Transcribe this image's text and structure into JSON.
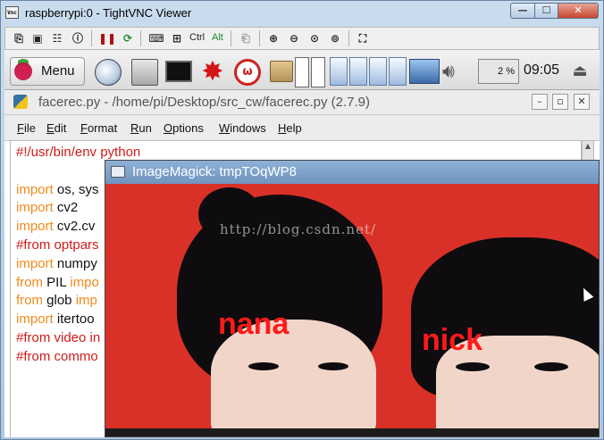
{
  "vnc": {
    "title": "raspberrypi:0 - TightVNC Viewer",
    "app_icon": "Vnc",
    "controls": {
      "minimize": "—",
      "maximize": "☐",
      "close": "✕"
    },
    "toolbar": {
      "ctrl_label": "Ctrl",
      "alt_label": "Alt"
    }
  },
  "panel": {
    "menu_label": "Menu",
    "cpu": "2 %",
    "clock": "09:05"
  },
  "idle": {
    "title": "facerec.py - /home/pi/Desktop/src_cw/facerec.py (2.7.9)",
    "controls": {
      "minimize": "–",
      "maximize": "▫",
      "close": "✕"
    },
    "menu": [
      "File",
      "Edit",
      "Format",
      "Run",
      "Options",
      "Windows",
      "Help"
    ],
    "code_lines": [
      [
        {
          "t": "#!/usr/bin/env python",
          "c": "cm"
        }
      ],
      [],
      [
        {
          "t": "import",
          "c": "kw"
        },
        {
          "t": " os, sys",
          "c": "tx"
        }
      ],
      [
        {
          "t": "import",
          "c": "kw"
        },
        {
          "t": " cv2",
          "c": "tx"
        }
      ],
      [
        {
          "t": "import",
          "c": "kw"
        },
        {
          "t": " cv2.cv",
          "c": "tx"
        }
      ],
      [
        {
          "t": "#from optpars",
          "c": "cm"
        }
      ],
      [
        {
          "t": "import",
          "c": "kw"
        },
        {
          "t": " numpy",
          "c": "tx"
        }
      ],
      [
        {
          "t": "from",
          "c": "kw"
        },
        {
          "t": " PIL ",
          "c": "tx"
        },
        {
          "t": "impo",
          "c": "kw"
        }
      ],
      [
        {
          "t": "from",
          "c": "kw"
        },
        {
          "t": " glob ",
          "c": "tx"
        },
        {
          "t": "imp",
          "c": "kw"
        }
      ],
      [
        {
          "t": "import",
          "c": "kw"
        },
        {
          "t": " itertoo",
          "c": "tx"
        }
      ],
      [
        {
          "t": "#from video in",
          "c": "cm"
        }
      ],
      [
        {
          "t": "#from commo",
          "c": "cm"
        }
      ]
    ]
  },
  "imagemagick": {
    "title": "ImageMagick: tmpTOqWP8",
    "watermark": "http://blog.csdn.net/",
    "labels": [
      "nana",
      "nick"
    ]
  },
  "colors": {
    "photo_background": "#d93128",
    "label_red": "#ff1a1a",
    "keyword_orange": "#f08a1c",
    "comment_red": "#d01a1a"
  }
}
